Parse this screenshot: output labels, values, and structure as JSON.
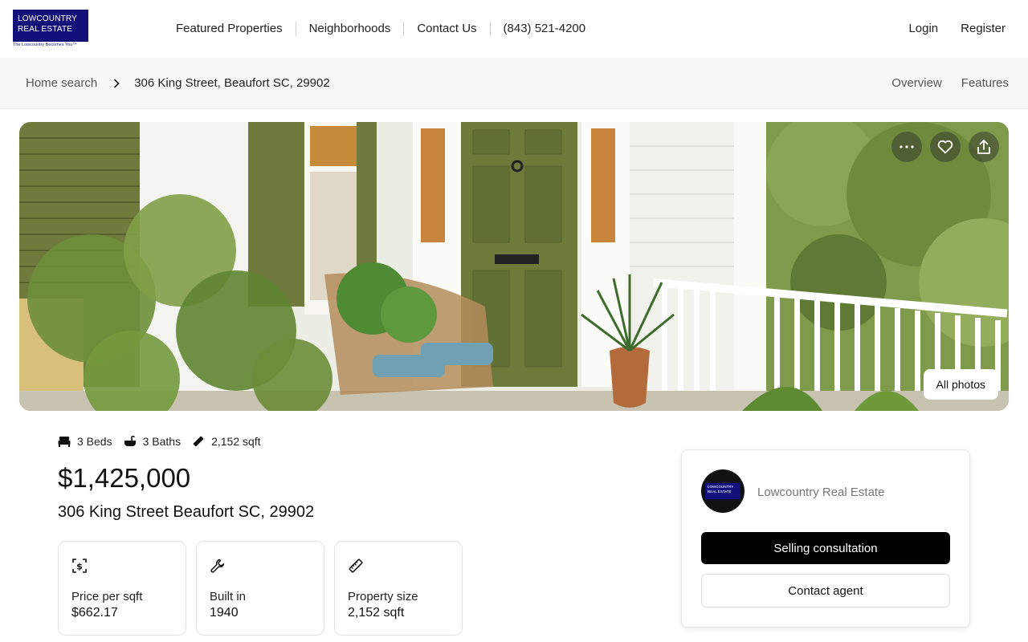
{
  "brand": {
    "line1": "LOWCOUNTRY",
    "line2": "REAL ESTATE",
    "tagline": "The Lowcountry Becomes You™"
  },
  "nav": {
    "links": [
      "Featured Properties",
      "Neighborhoods",
      "Contact Us",
      "(843) 521-4200"
    ],
    "login": "Login",
    "register": "Register"
  },
  "breadcrumb": {
    "home": "Home search",
    "current": "306 King Street, Beaufort SC, 29902"
  },
  "page_tabs": [
    "Overview",
    "Features"
  ],
  "hero": {
    "all_photos": "All photos",
    "actions": [
      "more-icon",
      "heart-icon",
      "share-icon"
    ]
  },
  "listing": {
    "beds": "3 Beds",
    "baths": "3 Baths",
    "sqft": "2,152 sqft",
    "price": "$1,425,000",
    "address": "306 King Street Beaufort SC, 29902"
  },
  "stats": [
    {
      "icon": "dollar-icon",
      "label": "Price per sqft",
      "value": "$662.17"
    },
    {
      "icon": "wrench-icon",
      "label": "Built in",
      "value": "1940"
    },
    {
      "icon": "ruler-icon",
      "label": "Property size",
      "value": "2,152 sqft"
    }
  ],
  "agent": {
    "name": "Lowcountry Real Estate",
    "primary_button": "Selling consultation",
    "secondary_button": "Contact agent"
  },
  "colors": {
    "brand_navy": "#14107a",
    "primary_button": "#000000",
    "door_green": "#6d7a3a"
  }
}
